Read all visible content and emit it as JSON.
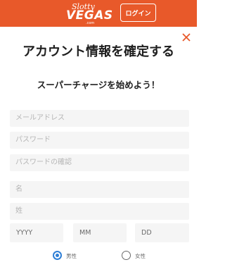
{
  "header": {
    "logo_script": "Slotty",
    "logo_main": "VEGAS",
    "logo_tag": ".com",
    "login_label": "ログイン"
  },
  "modal": {
    "close_icon": "close-icon",
    "title": "アカウント情報を確定する",
    "subtitle": "スーパーチャージを始めよう！"
  },
  "form": {
    "email_placeholder": "メールアドレス",
    "password_placeholder": "パスワード",
    "password_confirm_placeholder": "パスワードの確認",
    "first_name_placeholder": "名",
    "last_name_placeholder": "姓",
    "birth_year_placeholder": "YYYY",
    "birth_month_placeholder": "MM",
    "birth_day_placeholder": "DD",
    "gender": {
      "male_label": "男性",
      "female_label": "女性",
      "selected": "男性"
    }
  },
  "colors": {
    "header_bg": "#e8592a",
    "close_icon": "#e8592a",
    "radio_selected": "#2f7fd6"
  }
}
